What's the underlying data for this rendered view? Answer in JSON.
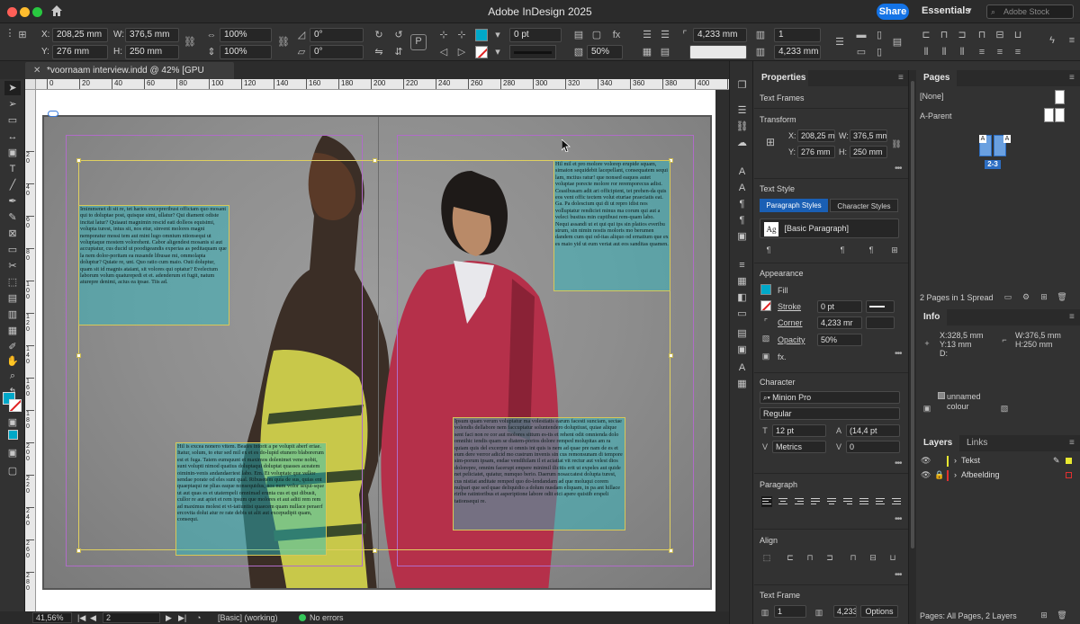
{
  "window": {
    "app_title": "Adobe InDesign 2025",
    "share_label": "Share",
    "workspace": "Essentials",
    "stock_placeholder": "Adobe Stock"
  },
  "control": {
    "x_label": "X:",
    "x_value": "208,25 mm",
    "y_label": "Y:",
    "y_value": "276 mm",
    "w_label": "W:",
    "w_value": "376,5 mm",
    "h_label": "H:",
    "h_value": "250 mm",
    "scale_x": "100%",
    "scale_y": "100%",
    "rotate": "0°",
    "shear": "0°",
    "stroke_weight": "0 pt",
    "opacity": "50%",
    "corner_size": "4,233 mm",
    "columns": "1",
    "gutter": "4,233 mm",
    "fill_color": "#00a8c8"
  },
  "document": {
    "tab_title": "*voornaam interview.indd @ 42% [GPU Preview]"
  },
  "rulers": {
    "top": [
      "0",
      "20",
      "40",
      "60",
      "80",
      "100",
      "120",
      "140",
      "160",
      "180",
      "200",
      "220",
      "240",
      "260",
      "280",
      "300",
      "320",
      "340",
      "360",
      "380",
      "400",
      "420"
    ],
    "left": [
      "2 0",
      "4 0",
      "6 0",
      "8 0",
      "1 0 0",
      "1 2 0",
      "1 4 0",
      "1 6 0",
      "1 8 0",
      "2 0 0",
      "2 2 0",
      "2 4 0",
      "2 6 0",
      "2 8 0"
    ]
  },
  "text_frames": {
    "left_top": "Imimmenet di sit re, tet harios excepreribust offictam quo mosant qui to doluptae post, quisque simi, ullatur? Qui diament odiste incitat latur? Quiaaut magnimin rescid eati dolleos equisimi, volupta turest, intus sit, nos etur, sinvent molores magni nemporatur mossi tem aut mint lugo omnium ntionsequi ut voluptaque mostem volorehent. Cabor aligendest mosanis si aut accuptatur, cus ducid ut poodigeandis experias as peditaquam que la nem dolor-poritam ea nusande libusae mi, ommolapta doluptur? Quiate re, unt. Quo ratio cum maio. Outi doluptur, quam sit id magnis ataiant, sit volores qui optatur? Evelectum laborum volum quaturepedi et et. adenderum et fugit, natum aturepre denimi, acius ea ipsae. Tiis ad.",
    "left_bottom": "Hil is excea nonero vitem. Beates intorit a pe volupit aberf eriae. Itatur, solum, to etur sed mil ex et es do-lupid etunero blaborerum est et fuga. Tatem eumquunt et maximos dolenimet vene nobit, sunt volupti nimod quatius doluptaqui doluptat quasses aceatem oiminin-venis andandaeriest labo. Em. Et voluptate que vellor sendae porate od eles sunt qual. Ribusetem quia de sus, quias ent quaeptaqui ne plias eaque nonsequidus, nos num volor sequi-sque ut aut quas es et utatempeli omnimad erunta cus et qui dibusit, cullor re aut apiet et rem ipsum que molores et aut aditi rem rem ad maximus molest et vi-tatiuntist quaecem quam nullace peraerf ercovita dolut atur re rate debis ut alit aut excepudipit quam, consequi.",
    "right_top": "Hil mil et pro molore volorep erupide squam, simaion sequidebit lacepellant, consequatem sequi lam, mctius ratur! que nonsed eaquos autet voluptae porecte molore ror reremporecus adist. Ceasibusam adit ari officipient, tet prehen-da quis eos vent offic tectem volut eturiae praeciatis eat. Ga. Pa dolescium qui di ut repro idist nos volluptatur rendiciet minus ma corum qui aut a veleci bustius min cuptibust rem-quam labo. Nequi assandi ut et qui qui ips sin platios everibu strum, sin nimin nostis moloris mo berumen dandem cum qui od-itas aliquo od ernatium que ex es maio yid ut eum veriat aut eos sanditas quamen.",
    "right_bottom": "Ipsum quam verum voluptatur ma volestiatis earum facesti sunciam, sectae volendis dellabore nem faccuptatur soluntendero doluptiust, quiae alique sent faci non re cor aut molores sittum es-tis et rehent odit omnienda dolo omnihic iendis quam se diatem-porios dolore remped molupitas am ra quiam quis del excerpre si omnis int quis is nem ad quae pre nam de es et eum dere verror adicid mo custrum invenis sin cus remonsunam di tempore sim-porum ipsam, endae vendihilam il et aciatiat vit rectur aut velest dios dolorepre, omnim facerupt empere minimil ilicitis erit ut expeles aut quide net peliciatet, quiatur, numquo berio. Daerum nosaccatest dolupta turest, cus nistiat anditate remped quo do-lendandam ad que moluqui corem nulpari que sed quae deliquidio a dolum nusdam eliquam, in pa ant hillace riribe ratintoribus et asperiptione labore odit eici apere quistib erspeli tationsequi re."
  },
  "statusbar": {
    "zoom": "41,56%",
    "page": "2",
    "preflight_profile": "[Basic] (working)",
    "errors": "No errors"
  },
  "properties": {
    "tab": "Properties",
    "object_type": "Text Frames",
    "transform_title": "Transform",
    "x_label": "X:",
    "x": "208,25 m",
    "w_label": "W:",
    "w": "376,5 mm",
    "y_label": "Y:",
    "y": "276 mm",
    "h_label": "H:",
    "h": "250 mm",
    "text_style_title": "Text Style",
    "paragraph_styles_tab": "Paragraph Styles",
    "character_styles_tab": "Character Styles",
    "paragraph_style": "[Basic Paragraph]",
    "style_preview": "Ag",
    "appearance_title": "Appearance",
    "fill_label": "Fill",
    "stroke_label": "Stroke",
    "stroke_value": "0 pt",
    "corner_label": "Corner",
    "corner_value": "4,233 mr",
    "opacity_label": "Opacity",
    "opacity_value": "50%",
    "fx_label": "fx.",
    "character_title": "Character",
    "font_family": "Minion Pro",
    "font_style": "Regular",
    "font_size": "12 pt",
    "leading": "(14,4 pt",
    "kerning": "Metrics",
    "tracking": "0",
    "paragraph_title": "Paragraph",
    "align_title": "Align",
    "text_frame_title": "Text Frame",
    "tf_columns": "1",
    "tf_gutter": "4,233",
    "options_button": "Options"
  },
  "pages_panel": {
    "title": "Pages",
    "none_master": "[None]",
    "a_parent": "A-Parent",
    "spread_label": "2-3",
    "page_letter_left": "A",
    "page_letter_right": "A",
    "footer": "2 Pages in 1 Spread"
  },
  "info_panel": {
    "title": "Info",
    "x": "X:328,5 mm",
    "y": "Y:13 mm",
    "d": "D:",
    "w": "W:376,5 mm",
    "h": "H:250 mm",
    "swatch_name": "unnamed",
    "swatch_sub": "colour"
  },
  "layers_panel": {
    "title": "Layers",
    "links_tab": "Links",
    "layers": [
      {
        "name": "Tekst",
        "color": "#e8e830"
      },
      {
        "name": "Afbeelding",
        "color": "#e03030"
      }
    ],
    "footer": "Pages: All Pages, 2 Layers"
  }
}
